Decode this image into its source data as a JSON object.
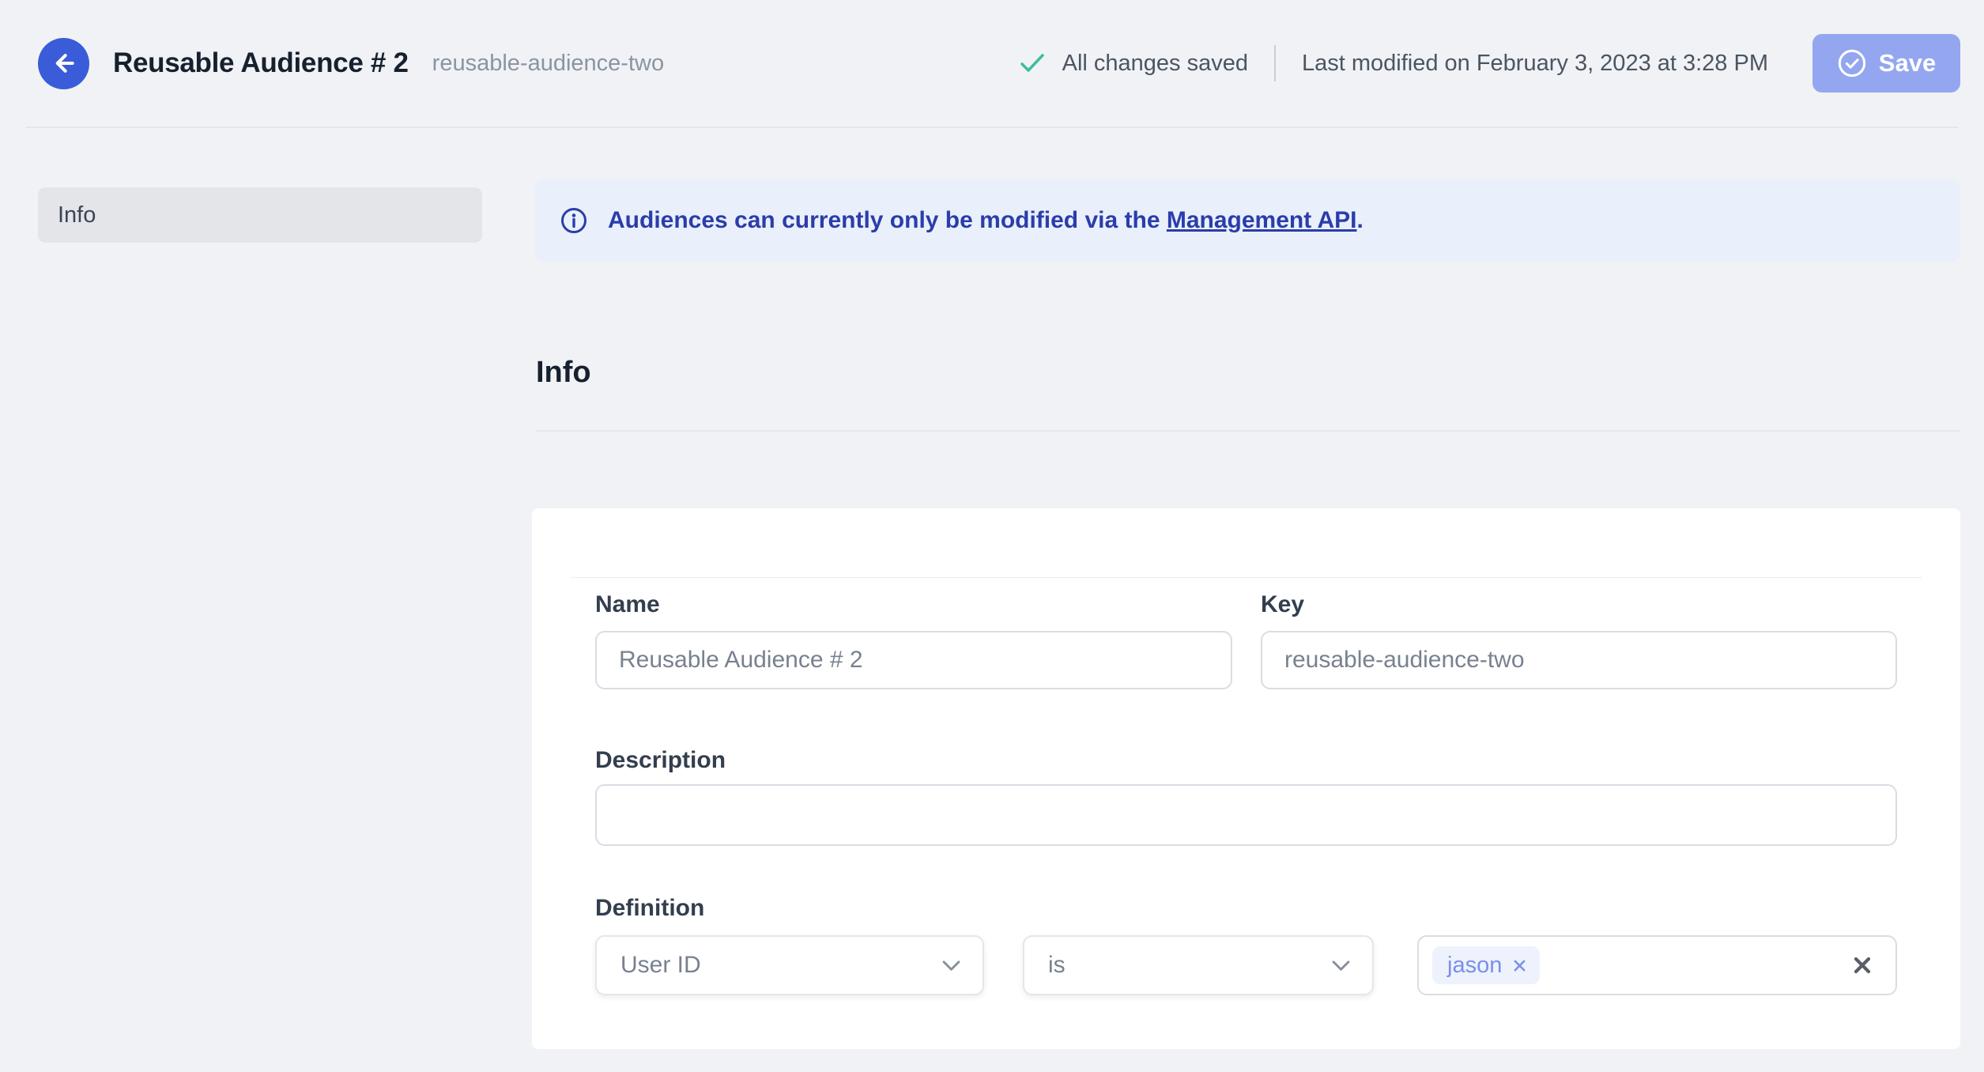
{
  "header": {
    "title": "Reusable Audience # 2",
    "subtitle": "reusable-audience-two",
    "status_text": "All changes saved",
    "last_modified": "Last modified on February 3, 2023 at 3:28 PM",
    "save_label": "Save"
  },
  "sidebar": {
    "items": [
      {
        "label": "Info",
        "active": true
      }
    ]
  },
  "banner": {
    "text_before_link": "Audiences can currently only be modified via the ",
    "link_text": "Management API",
    "text_after_link": "."
  },
  "section": {
    "title": "Info"
  },
  "form": {
    "name": {
      "label": "Name",
      "value": "Reusable Audience # 2"
    },
    "key": {
      "label": "Key",
      "value": "reusable-audience-two"
    },
    "description": {
      "label": "Description",
      "value": ""
    },
    "definition": {
      "label": "Definition",
      "trait_select": {
        "selected": "User ID"
      },
      "operator_select": {
        "selected": "is"
      },
      "value_tags": [
        {
          "label": "jason"
        }
      ]
    }
  },
  "colors": {
    "page_bg": "#F1F2F5",
    "accent_blue": "#3A5CD8",
    "save_button": "#94A6EF",
    "banner_bg": "#E9F0FC",
    "banner_text": "#2B3DA9",
    "success_green": "#3CBD9E",
    "tag_bg": "#EDF2FD",
    "tag_text": "#7B8EE8",
    "input_border": "#D9DDE4",
    "text_dark": "#17202E",
    "text_gray": "#78818F"
  }
}
